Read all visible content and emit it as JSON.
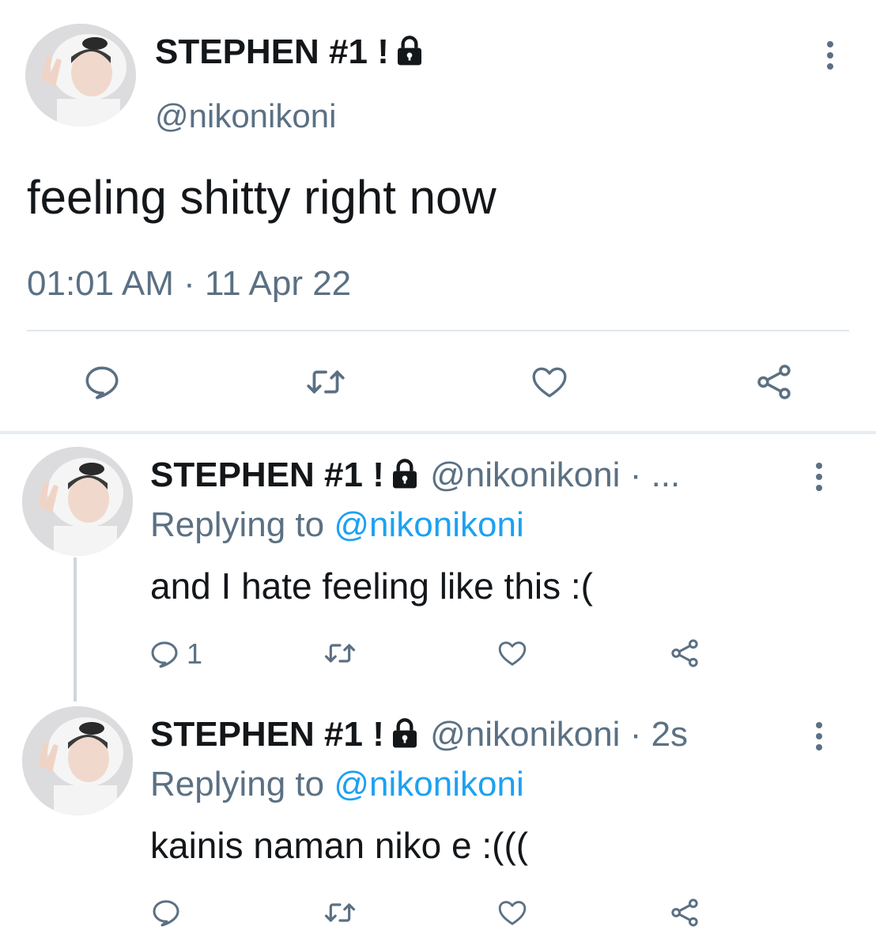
{
  "main_tweet": {
    "display_name": "STEPHEN #1 !",
    "handle": "@nikonikoni",
    "text": "feeling shitty right now",
    "time": "01:01 AM",
    "separator": "·",
    "date": "11 Apr 22"
  },
  "replies": [
    {
      "display_name": "STEPHEN #1 !",
      "handle": "@nikonikoni",
      "meta": "· ...",
      "replying_label": "Replying to",
      "replying_handle": "@nikonikoni",
      "text": "and I hate feeling like this :(",
      "reply_count": "1"
    },
    {
      "display_name": "STEPHEN #1 !",
      "handle": "@nikonikoni",
      "meta": "· 2s",
      "replying_label": "Replying to",
      "replying_handle": "@nikonikoni",
      "text": "kainis naman niko e :(((",
      "reply_count": ""
    }
  ],
  "icons": [
    "lock-icon",
    "more-icon",
    "reply-icon",
    "retweet-icon",
    "like-icon",
    "share-icon"
  ],
  "colors": {
    "text": "#14171a",
    "secondary": "#5b7083",
    "accent": "#1da1f2",
    "divider": "#e1e8ed"
  }
}
